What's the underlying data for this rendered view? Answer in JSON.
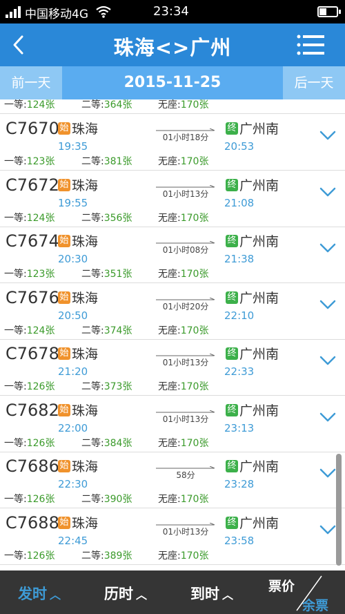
{
  "status_bar": {
    "carrier": "中国移动4G",
    "time": "23:34",
    "icons": [
      "signal-icon",
      "wifi-icon",
      "battery-icon"
    ]
  },
  "header": {
    "title": "珠海<>广州",
    "back_icon": "back-arrow-icon",
    "menu_icon": "menu-icon"
  },
  "date_bar": {
    "prev_label": "前一天",
    "date": "2015-11-25",
    "next_label": "后一天"
  },
  "partial_row": {
    "first": "一等:",
    "first_count": "124张",
    "second": "二等:",
    "second_count": "364张",
    "standing": "无座:",
    "standing_count": "170张"
  },
  "trains": [
    {
      "no": "C7670",
      "start_badge": "始",
      "from": "珠海",
      "dep": "19:35",
      "duration": "01小时18分",
      "end_badge": "终",
      "to": "广州南",
      "arr": "20:53",
      "first": "一等:",
      "first_count": "123张",
      "second": "二等:",
      "second_count": "381张",
      "standing": "无座:",
      "standing_count": "170张"
    },
    {
      "no": "C7672",
      "start_badge": "始",
      "from": "珠海",
      "dep": "19:55",
      "duration": "01小时13分",
      "end_badge": "终",
      "to": "广州南",
      "arr": "21:08",
      "first": "一等:",
      "first_count": "124张",
      "second": "二等:",
      "second_count": "356张",
      "standing": "无座:",
      "standing_count": "170张"
    },
    {
      "no": "C7674",
      "start_badge": "始",
      "from": "珠海",
      "dep": "20:30",
      "duration": "01小时08分",
      "end_badge": "终",
      "to": "广州南",
      "arr": "21:38",
      "first": "一等:",
      "first_count": "123张",
      "second": "二等:",
      "second_count": "351张",
      "standing": "无座:",
      "standing_count": "170张"
    },
    {
      "no": "C7676",
      "start_badge": "始",
      "from": "珠海",
      "dep": "20:50",
      "duration": "01小时20分",
      "end_badge": "终",
      "to": "广州南",
      "arr": "22:10",
      "first": "一等:",
      "first_count": "124张",
      "second": "二等:",
      "second_count": "374张",
      "standing": "无座:",
      "standing_count": "170张"
    },
    {
      "no": "C7678",
      "start_badge": "始",
      "from": "珠海",
      "dep": "21:20",
      "duration": "01小时13分",
      "end_badge": "终",
      "to": "广州南",
      "arr": "22:33",
      "first": "一等:",
      "first_count": "126张",
      "second": "二等:",
      "second_count": "373张",
      "standing": "无座:",
      "standing_count": "170张"
    },
    {
      "no": "C7682",
      "start_badge": "始",
      "from": "珠海",
      "dep": "22:00",
      "duration": "01小时13分",
      "end_badge": "终",
      "to": "广州南",
      "arr": "23:13",
      "first": "一等:",
      "first_count": "126张",
      "second": "二等:",
      "second_count": "384张",
      "standing": "无座:",
      "standing_count": "170张"
    },
    {
      "no": "C7686",
      "start_badge": "始",
      "from": "珠海",
      "dep": "22:30",
      "duration": "58分",
      "end_badge": "终",
      "to": "广州南",
      "arr": "23:28",
      "first": "一等:",
      "first_count": "126张",
      "second": "二等:",
      "second_count": "390张",
      "standing": "无座:",
      "standing_count": "170张"
    },
    {
      "no": "C7688",
      "start_badge": "始",
      "from": "珠海",
      "dep": "22:45",
      "duration": "01小时13分",
      "end_badge": "终",
      "to": "广州南",
      "arr": "23:58",
      "first": "一等:",
      "first_count": "126张",
      "second": "二等:",
      "second_count": "389张",
      "standing": "无座:",
      "standing_count": "170张"
    }
  ],
  "sort_bar": {
    "departure": "发时",
    "duration": "历时",
    "arrival": "到时",
    "fare": "票价",
    "remaining": "余票",
    "active": "departure"
  },
  "colors": {
    "header_blue": "#2a88d8",
    "date_bar_blue": "#5aacf0",
    "time_blue": "#3e9bd6",
    "start_badge": "#f0922c",
    "end_badge": "#3cb04a",
    "count_green": "#3a9a2a",
    "sort_bar_bg": "#353535"
  }
}
